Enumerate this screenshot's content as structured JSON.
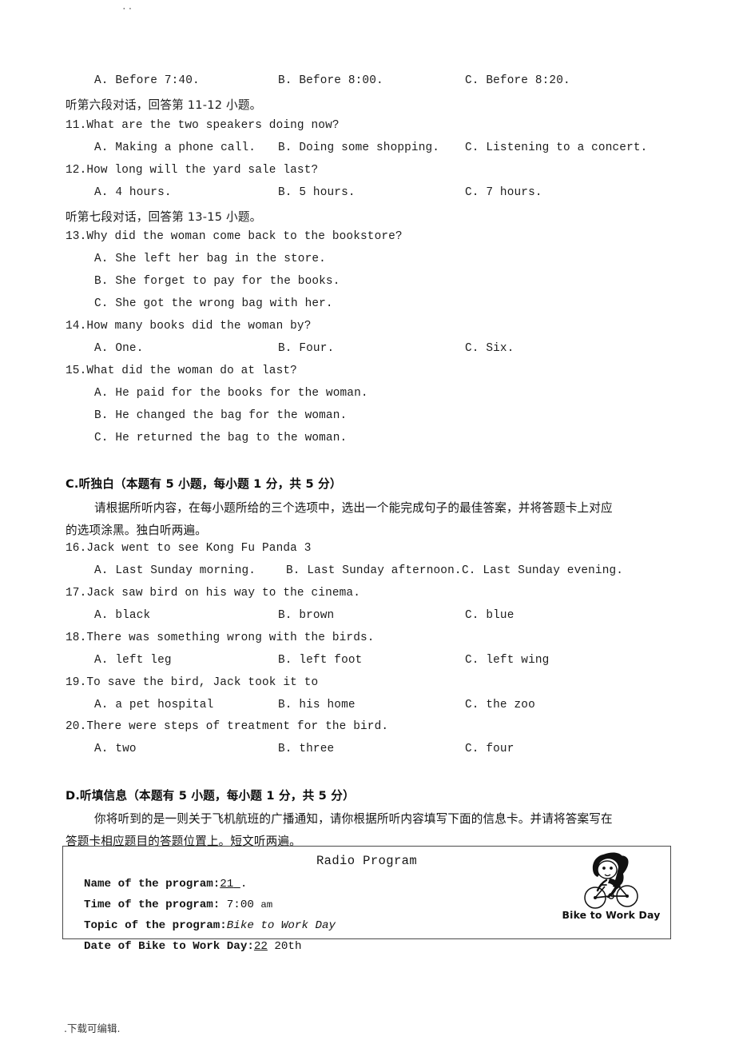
{
  "page": {
    "top_mark": "··",
    "footer": ".下载可编辑."
  },
  "questions": [
    {
      "id": "q10-options",
      "options": [
        "A. Before 7:40.",
        "B. Before 8:00.",
        "C. Before 8:20."
      ]
    }
  ],
  "blocks": {
    "listen6_instruction": "听第六段对话，回答第 11-12 小题。",
    "q11_stem": "11.What are the two speakers doing now?",
    "q11_options": [
      "A. Making a phone call.",
      "B. Doing some shopping.",
      "C. Listening to a concert."
    ],
    "q12_stem": "12.How long will the yard sale last?",
    "q12_options": [
      "A. 4 hours.",
      "B. 5 hours.",
      "C. 7 hours."
    ],
    "listen7_instruction": "听第七段对话，回答第 13-15 小题。",
    "q13_stem": "13.Why did the woman come back to the bookstore?",
    "q13_options": [
      "A. She left her bag in the store.",
      "B. She forget to pay for the books.",
      "C. She got the wrong bag with her."
    ],
    "q14_stem": "14.How many books did the woman by?",
    "q14_options": [
      "A. One.",
      "B. Four.",
      "C. Six."
    ],
    "q15_stem": "15.What did the woman do at last?",
    "q15_options": [
      "A. He paid for the books for the woman.",
      "B. He changed the bag for the woman.",
      "C. He returned the bag to the woman."
    ],
    "sectionC_title": "C.听独白（本题有 5 小题，每小题 1 分，共 5 分）",
    "sectionC_para_line1": "请根据所听内容，在每小题所给的三个选项中，选出一个能完成句子的最佳答案，并将答题卡上对应",
    "sectionC_para_line2": "的选项涂黑。独白听两遍。",
    "q16_stem": "16.Jack went to see Kong Fu Panda 3",
    "q16_options": [
      "A. Last Sunday morning.",
      "B. Last Sunday afternoon.",
      "C. Last Sunday evening."
    ],
    "q17_stem": "17.Jack saw bird on his way to the cinema.",
    "q17_options": [
      "A. black",
      "B. brown",
      "C. blue"
    ],
    "q18_stem": "18.There was something wrong with the birds.",
    "q18_options": [
      "A. left leg",
      "B. left foot",
      "C. left wing"
    ],
    "q19_stem": "19.To save the bird, Jack took it to",
    "q19_options": [
      "A. a pet hospital",
      "B. his home",
      "C. the zoo"
    ],
    "q20_stem": "20.There were steps of treatment for the bird.",
    "q20_options": [
      "A. two",
      "B. three",
      "C. four"
    ],
    "sectionD_title": "D.听填信息（本题有 5 小题，每小题 1 分，共 5 分）",
    "sectionD_para_line1": "你将听到的是一则关于飞机航班的广播通知，请你根据所听内容填写下面的信息卡。并请将答案写在",
    "sectionD_para_line2": "答题卡相应题目的答题位置上。短文听两遍。"
  },
  "radio_program": {
    "title": "Radio Program",
    "rows": [
      {
        "label": "Name of the program:",
        "blank": "21",
        "after": "."
      },
      {
        "label": "Time of the program:",
        "value": "7:00",
        "unit": "am"
      },
      {
        "label": "Topic of the program:",
        "italic_value": "Bike to Work Day"
      },
      {
        "label": "Date of Bike to Work Day:",
        "blank": "22",
        "after": "20th"
      }
    ],
    "illustration_caption": "Bike to Work Day"
  }
}
